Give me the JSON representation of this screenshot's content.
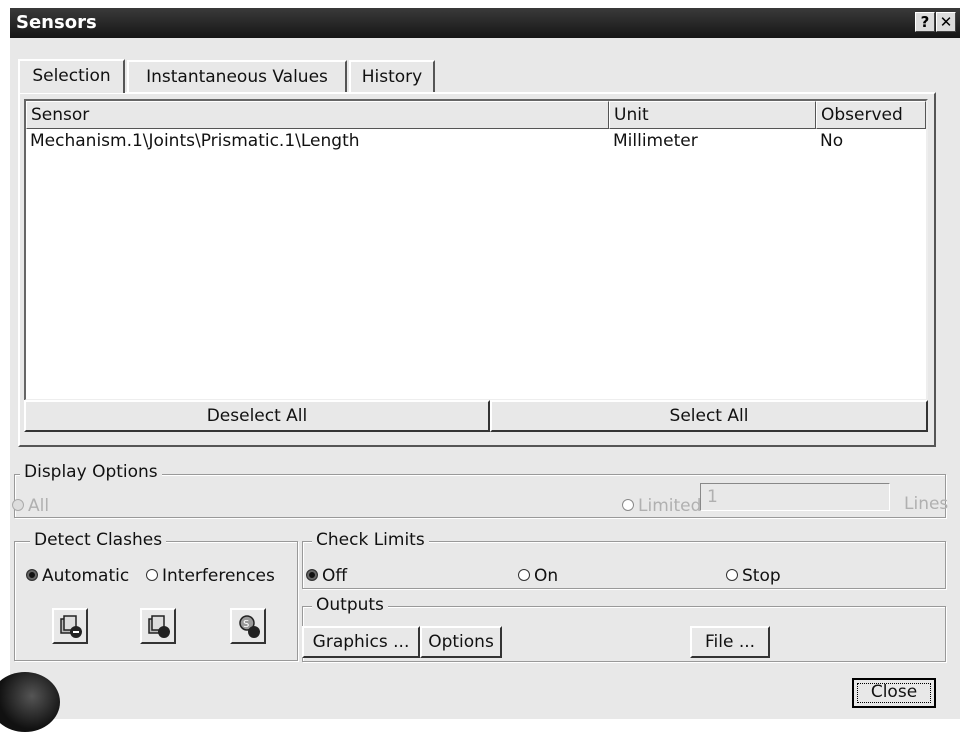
{
  "window": {
    "title": "Sensors",
    "help_label": "?",
    "close_label": "✕"
  },
  "tabs": [
    {
      "label": "Selection",
      "active": true
    },
    {
      "label": "Instantaneous Values",
      "active": false
    },
    {
      "label": "History",
      "active": false
    }
  ],
  "sensor_table": {
    "columns": [
      "Sensor",
      "Unit",
      "Observed"
    ],
    "rows": [
      {
        "sensor": "Mechanism.1\\Joints\\Prismatic.1\\Length",
        "unit": "Millimeter",
        "observed": "No"
      }
    ]
  },
  "buttons": {
    "deselect_all": "Deselect All",
    "select_all": "Select All",
    "close": "Close"
  },
  "display_options": {
    "label": "Display Options",
    "all_label": "All",
    "limited_label": "Limited",
    "limited_value": "1",
    "lines_label": "Lines",
    "selected": "All",
    "enabled": false
  },
  "detect_clashes": {
    "label": "Detect Clashes",
    "automatic_label": "Automatic",
    "interferences_label": "Interferences",
    "selected": "Automatic",
    "icons": [
      "clash-stop-icon",
      "clash-detect-icon",
      "clash-off-icon"
    ]
  },
  "check_limits": {
    "label": "Check Limits",
    "options": [
      "Off",
      "On",
      "Stop"
    ],
    "selected": "Off"
  },
  "outputs": {
    "label": "Outputs",
    "graphics_label": "Graphics ...",
    "options_label": "Options",
    "file_label": "File ..."
  }
}
